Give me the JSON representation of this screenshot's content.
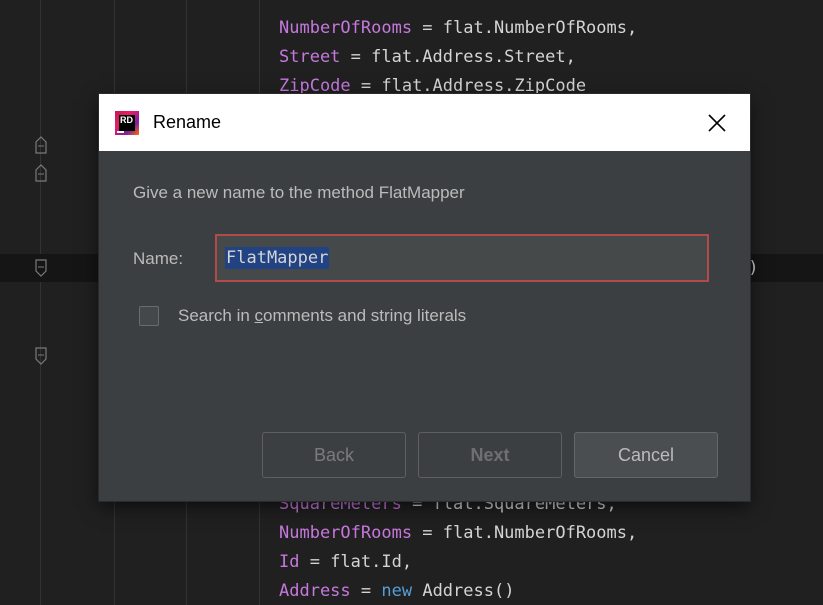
{
  "editor": {
    "top_lines": [
      {
        "prop": "NumberOfRooms",
        "rest": " = flat.NumberOfRooms,",
        "trail": ""
      },
      {
        "prop": "Street",
        "rest": " = flat.Address.Street,",
        "trail": ""
      },
      {
        "prop": "ZipCode",
        "rest": " = flat.Address.ZipCode",
        "trail": ""
      }
    ],
    "bottom_lines": [
      {
        "prop": "SquareMeters",
        "rest": " = flat.SquareMeters,",
        "trail": ""
      },
      {
        "prop": "NumberOfRooms",
        "rest": " = flat.NumberOfRooms,",
        "trail": ""
      },
      {
        "prop": "Id",
        "rest": " = flat.Id,",
        "trail": ""
      },
      {
        "prop": "Address",
        "rest": " = ",
        "kw": "new",
        "type": " Address()"
      }
    ],
    "stray_text": ":)"
  },
  "dialog": {
    "title": "Rename",
    "description": "Give a new name to the method FlatMapper",
    "name_label": "Name:",
    "name_value": "FlatMapper",
    "checkbox": {
      "label_before": "Search in ",
      "label_underlined": "c",
      "label_after": "omments and string literals",
      "checked": false
    },
    "buttons": {
      "back": "Back",
      "next": "Next",
      "cancel": "Cancel"
    }
  },
  "colors": {
    "accent_border": "#b14a4a",
    "selection": "#214283",
    "property": "#c678dd",
    "keyword": "#569cd6"
  }
}
